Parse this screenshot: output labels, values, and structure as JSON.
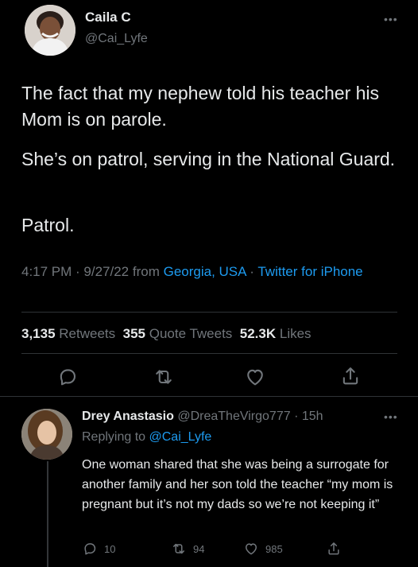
{
  "main_tweet": {
    "author_name": "Caila C",
    "author_handle": "@Cai_Lyfe",
    "more_icon": "more-icon",
    "paragraphs": [
      "The fact that my nephew told his teacher his Mom is on parole.",
      "She’s on patrol, serving in the National Guard.",
      "Patrol."
    ],
    "time_date": "4:17 PM · 9/27/22 from ",
    "location": "Georgia, USA",
    "separator": " · ",
    "client": "Twitter for iPhone",
    "stats": {
      "retweets_count": "3,135",
      "retweets_label": "Retweets",
      "quote_count": "355",
      "quote_label": "Quote Tweets",
      "likes_count": "52.3K",
      "likes_label": "Likes"
    }
  },
  "reply": {
    "author_name": "Drey Anastasio",
    "author_handle": "@DreaTheVirgo777",
    "time": "· 15h",
    "replying_prefix": "Replying to ",
    "replying_handle": "@Cai_Lyfe",
    "text": "One woman shared that she was being a surrogate for another family and her son told the teacher “my mom is pregnant but it’s not my dads so we’re not keeping it”",
    "replies": "10",
    "retweets": "94",
    "likes": "985"
  },
  "colors": {
    "background": "#000000",
    "text": "#e7e9ea",
    "muted": "#71767b",
    "link": "#1d9bf0",
    "divider": "#2f3336"
  }
}
